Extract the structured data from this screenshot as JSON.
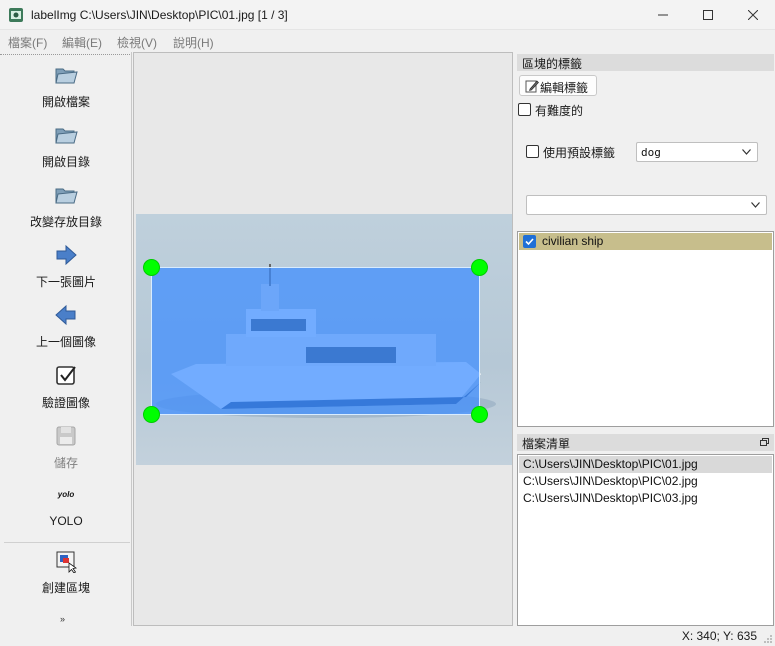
{
  "window": {
    "title": "labelImg C:\\Users\\JIN\\Desktop\\PIC\\01.jpg [1 / 3]"
  },
  "menu": [
    "檔案(F)",
    "編輯(E)",
    "檢視(V)",
    "說明(H)"
  ],
  "toolbar": {
    "items": [
      {
        "label": "開啟檔案",
        "icon": "open-folder-icon",
        "enabled": true
      },
      {
        "label": "開啟目錄",
        "icon": "open-folder-icon",
        "enabled": true
      },
      {
        "label": "改變存放目錄",
        "icon": "open-folder-icon",
        "enabled": true
      },
      {
        "label": "下一張圖片",
        "icon": "arrow-right-icon",
        "enabled": true
      },
      {
        "label": "上一個圖像",
        "icon": "arrow-left-icon",
        "enabled": true
      },
      {
        "label": "驗證圖像",
        "icon": "check-box-icon",
        "enabled": true
      },
      {
        "label": "儲存",
        "icon": "floppy-disk-icon",
        "enabled": false
      },
      {
        "label": "YOLO",
        "icon": "yolo-format-icon",
        "icon_text": "yolo",
        "enabled": true
      },
      {
        "label": "創建區塊",
        "icon": "create-box-icon",
        "enabled": true
      }
    ]
  },
  "box_labels_panel": {
    "title": "區塊的標籤",
    "edit_button": "編輯標籤",
    "difficult_label": "有難度的",
    "difficult_checked": false,
    "default_label_text": "使用預設標籤",
    "default_label_checked": false,
    "default_label_value": "dog",
    "label_filter_value": "",
    "labels": [
      {
        "text": "civilian ship",
        "checked": true
      }
    ]
  },
  "file_list_panel": {
    "title": "檔案清單",
    "files": [
      "C:\\Users\\JIN\\Desktop\\PIC\\01.jpg",
      "C:\\Users\\JIN\\Desktop\\PIC\\02.jpg",
      "C:\\Users\\JIN\\Desktop\\PIC\\03.jpg"
    ],
    "selected_index": 0
  },
  "status": {
    "text": "X: 340; Y: 635"
  },
  "colors": {
    "bbox_fill": "#3c8cff",
    "handle": "#00ff00",
    "label_selected_bg": "#c7be8c",
    "file_selected_bg": "#d9d9d9"
  }
}
